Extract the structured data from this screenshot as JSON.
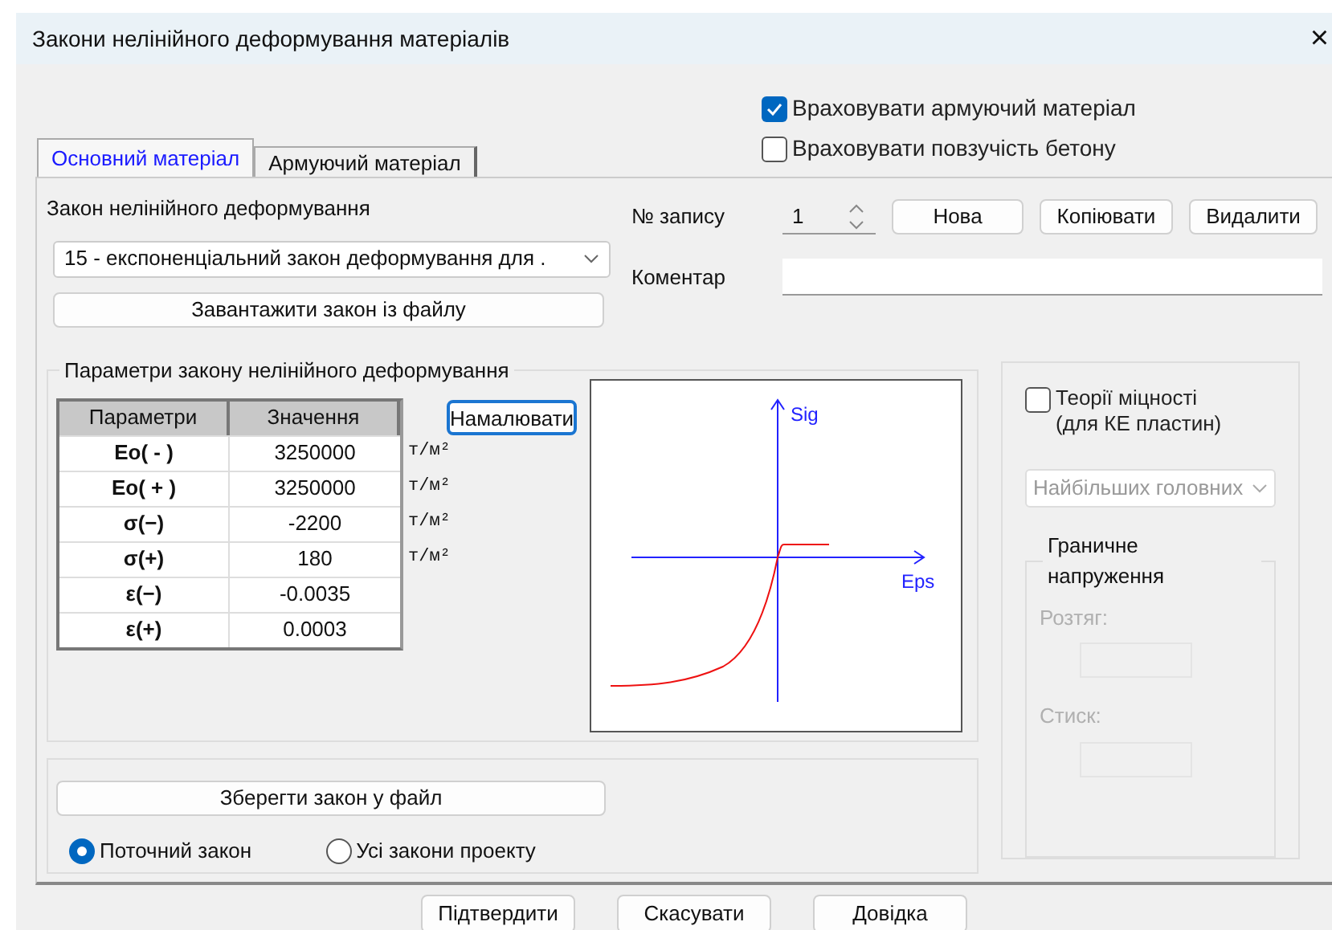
{
  "window": {
    "title": "Закони нелінійного деформування матеріалів",
    "close": "×"
  },
  "tabs": [
    {
      "label": "Основний матеріал",
      "selected": true
    },
    {
      "label": "Армуючий матеріал",
      "selected": false
    }
  ],
  "options": [
    {
      "label": "Враховувати армуючий матеріал",
      "checked": true
    },
    {
      "label": "Враховувати повзучість бетону",
      "checked": false
    }
  ],
  "law": {
    "label": "Закон нелінійного деформування",
    "value": "15 - експоненціальний закон деформування для .",
    "load_button": "Завантажити закон із файлу"
  },
  "record": {
    "label": "№ запису",
    "value": "1",
    "buttons": [
      "Нова",
      "Копіювати",
      "Видалити"
    ],
    "comment_label": "Коментар"
  },
  "parameters": {
    "title": "Параметри закону нелінійного деформування",
    "columns": [
      "Параметри",
      "Значення"
    ],
    "rows": [
      {
        "name": "Eo( - )",
        "value": "3250000",
        "unit": "т/м²"
      },
      {
        "name": "Eo( + )",
        "value": "3250000",
        "unit": "т/м²"
      },
      {
        "name": "σ(−)",
        "value": "-2200",
        "unit": "т/м²"
      },
      {
        "name": "σ(+)",
        "value": "180",
        "unit": "т/м²"
      },
      {
        "name": "ε(−)",
        "value": "-0.0035"
      },
      {
        "name": "ε(+)",
        "value": "0.0003"
      }
    ],
    "draw_button": "Намалювати",
    "plot": {
      "y_label": "Sig",
      "x_label": "Eps"
    }
  },
  "strength": {
    "label": "Теорії міцності\n(для КЕ пластин)",
    "checked": false,
    "disabled": true,
    "theory": "Найбільших головних",
    "limit_title": "Граничне напруження",
    "tension_label": "Розтяг:",
    "compression_label": "Стиск:"
  },
  "save": {
    "button": "Зберегти закон у файл",
    "scope": [
      {
        "label": "Поточний закон",
        "selected": true
      },
      {
        "label": "Усі закони проекту",
        "selected": false
      }
    ]
  },
  "footer_buttons": [
    "Підтвердити",
    "Скасувати",
    "Довідка"
  ]
}
